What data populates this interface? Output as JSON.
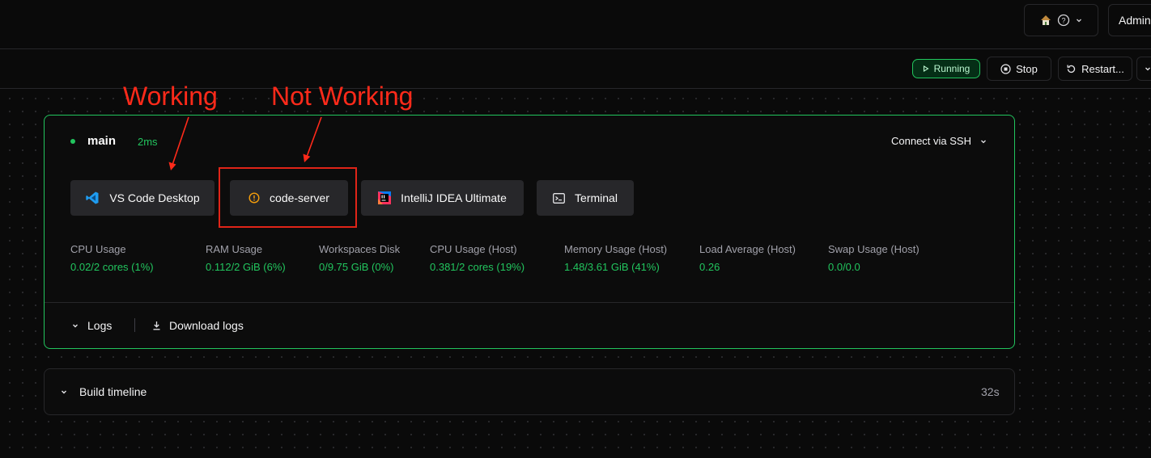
{
  "header": {
    "help_icon": "help-icon",
    "admin_label": "Admin"
  },
  "workspace_actions": {
    "status": "Running",
    "stop_label": "Stop",
    "restart_label": "Restart..."
  },
  "agent": {
    "name": "main",
    "latency": "2ms",
    "connect_label": "Connect via SSH",
    "apps": [
      {
        "label": "VS Code Desktop",
        "icon": "vscode-icon"
      },
      {
        "label": "code-server",
        "icon": "warning-icon"
      },
      {
        "label": "IntelliJ IDEA Ultimate",
        "icon": "intellij-icon"
      },
      {
        "label": "Terminal",
        "icon": "terminal-icon"
      }
    ],
    "stats": [
      {
        "label": "CPU Usage",
        "value": "0.02/2 cores (1%)"
      },
      {
        "label": "RAM Usage",
        "value": "0.112/2 GiB (6%)"
      },
      {
        "label": "Workspaces Disk",
        "value": "0/9.75 GiB (0%)"
      },
      {
        "label": "CPU Usage (Host)",
        "value": "0.381/2 cores (19%)"
      },
      {
        "label": "Memory Usage (Host)",
        "value": "1.48/3.61 GiB (41%)"
      },
      {
        "label": "Load Average (Host)",
        "value": "0.26"
      },
      {
        "label": "Swap Usage (Host)",
        "value": "0.0/0.0"
      }
    ],
    "logs_label": "Logs",
    "download_logs_label": "Download logs"
  },
  "build_timeline": {
    "label": "Build timeline",
    "duration": "32s"
  },
  "annotations": {
    "working": "Working",
    "not_working": "Not Working"
  },
  "colors": {
    "accent_green": "#22c55e",
    "annotation_red": "#ff2a1a",
    "warning_orange": "#f59e0b"
  }
}
